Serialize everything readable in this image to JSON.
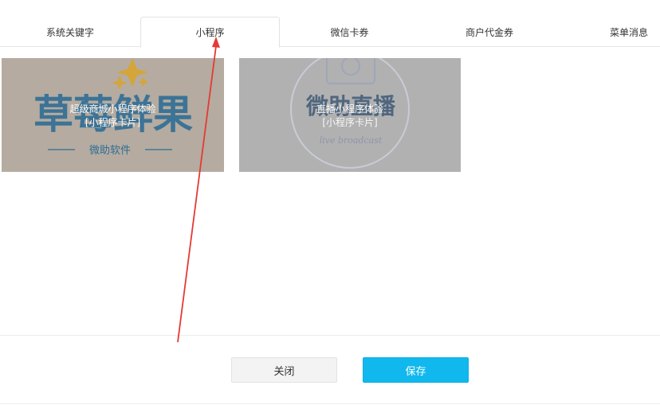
{
  "tabs": [
    {
      "label": "系统关键字"
    },
    {
      "label": "小程序"
    },
    {
      "label": "微信卡券"
    },
    {
      "label": "商户代金券"
    },
    {
      "label": "菜单消息"
    }
  ],
  "cards": [
    {
      "title": "超级商城小程序体验",
      "subtitle": "[小程序卡片]",
      "image_text_main": "草莓鲜果",
      "image_text_sub": "微助软件"
    },
    {
      "title": "直播小程序体验",
      "subtitle": "[小程序卡片]",
      "image_text_main": "微助直播",
      "image_text_sub": "live broadcast"
    }
  ],
  "footer": {
    "close_label": "关闭",
    "save_label": "保存"
  },
  "colors": {
    "accent": "#10b8ee",
    "annotation_arrow": "#e53935"
  }
}
